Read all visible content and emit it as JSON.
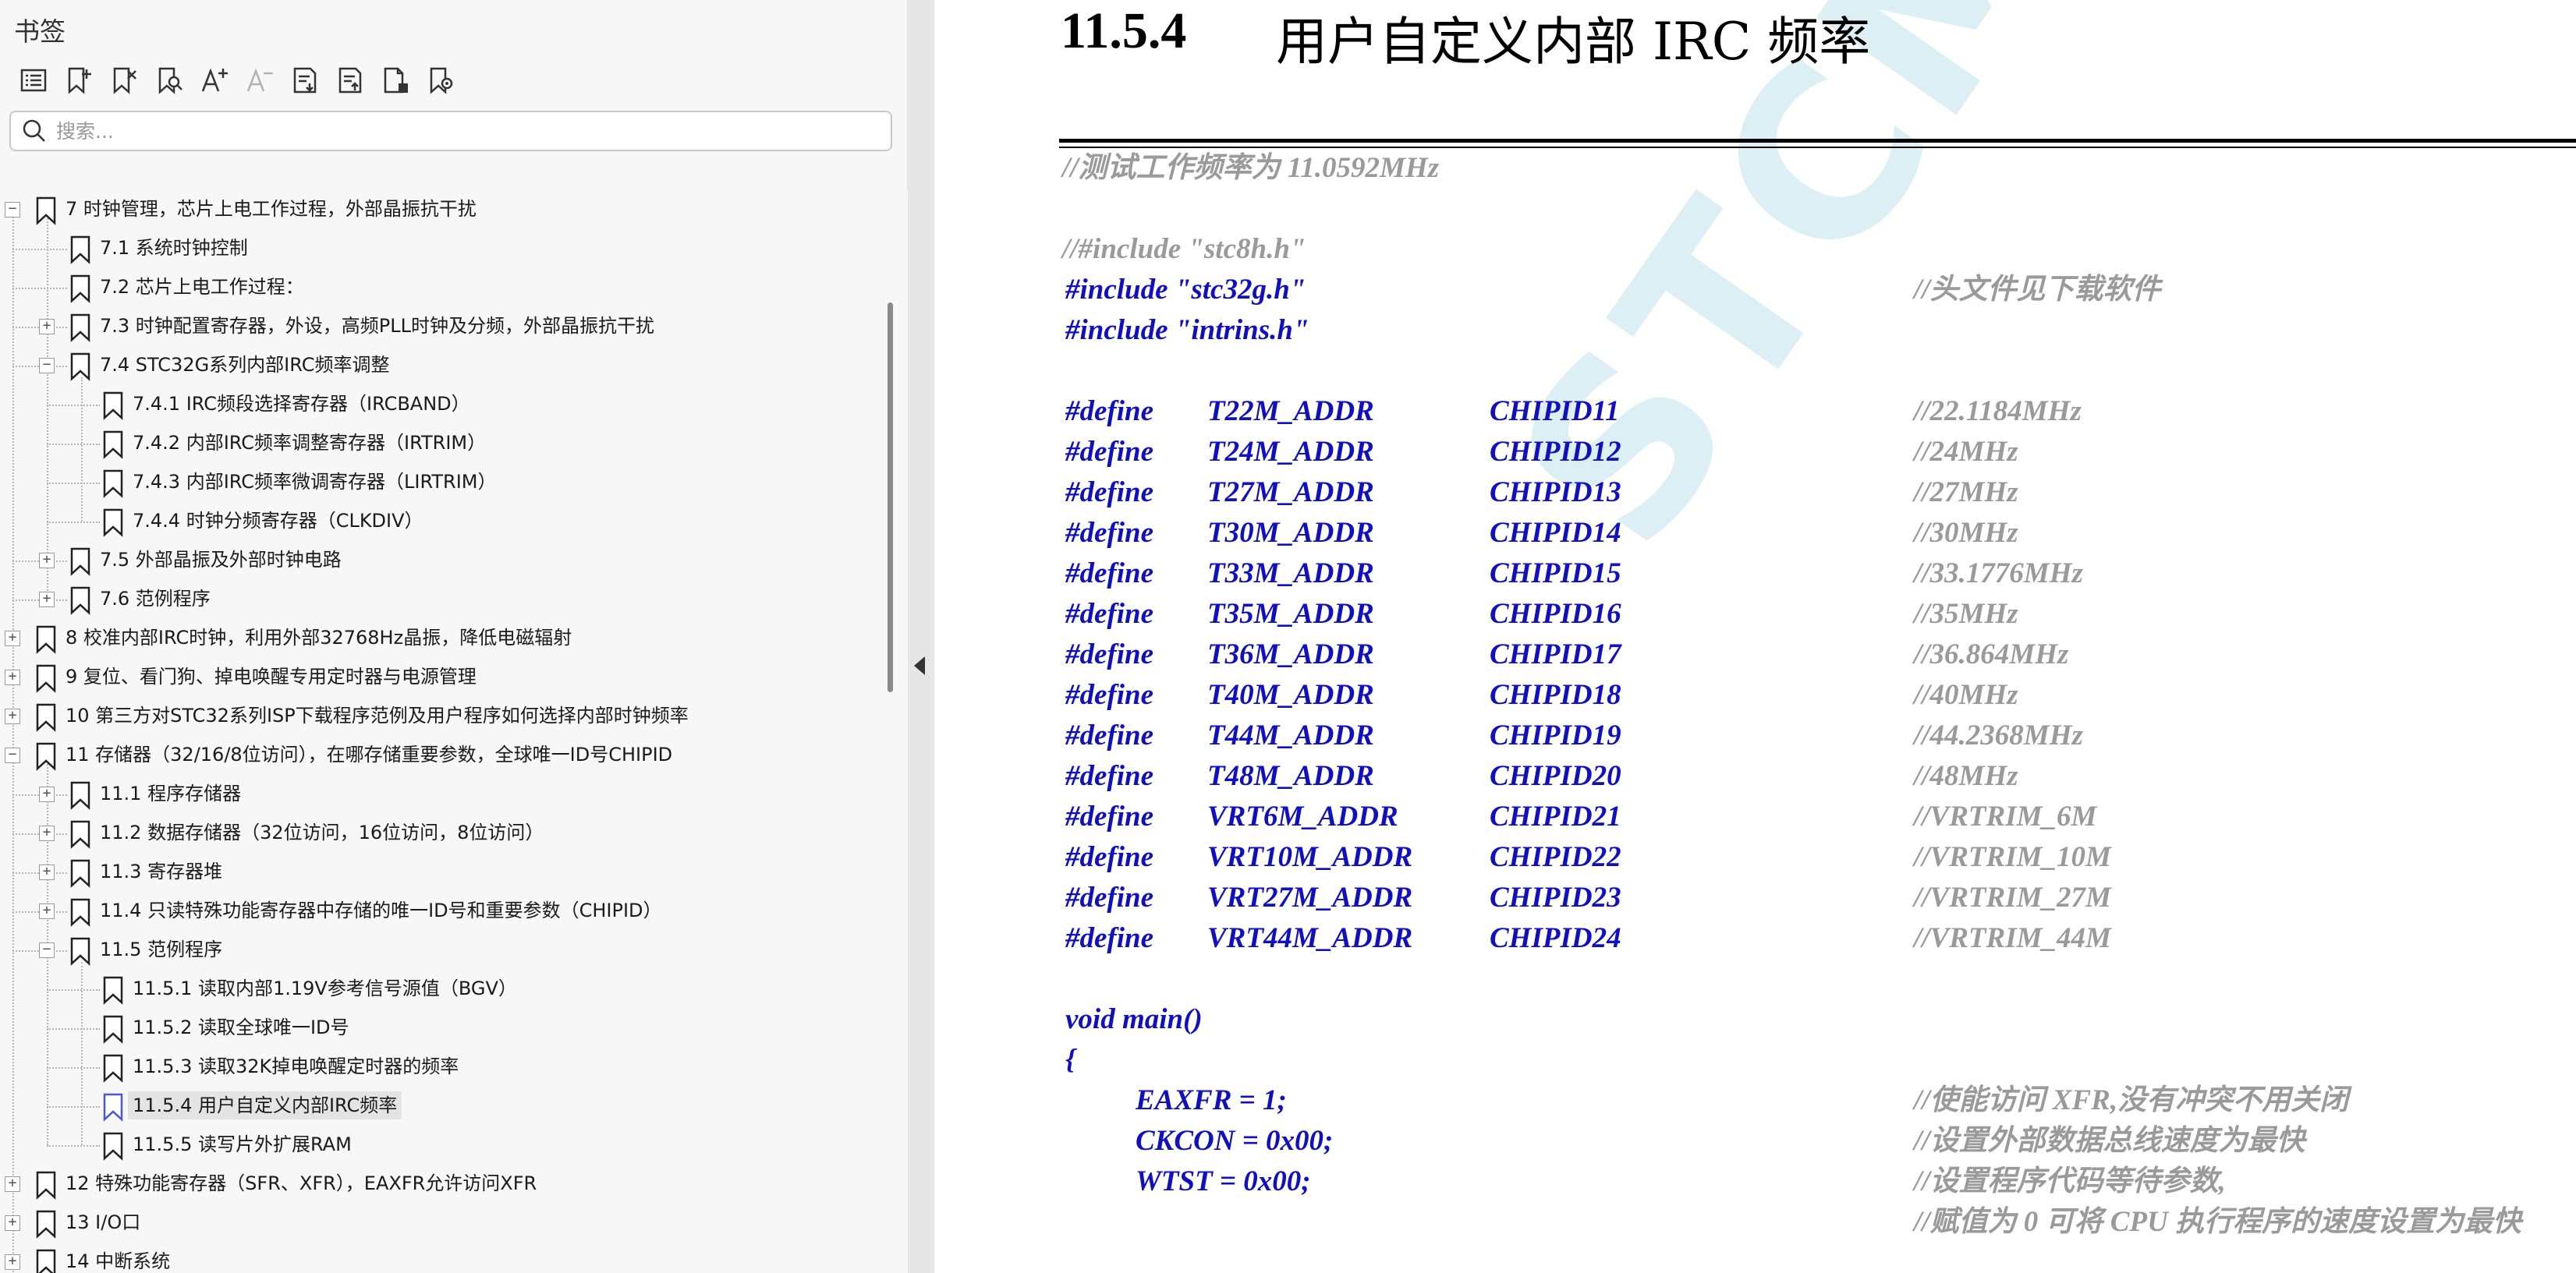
{
  "sidebar": {
    "title": "书签",
    "search_placeholder": "搜索...",
    "toolbar": [
      {
        "icon": "list-view-icon"
      },
      {
        "icon": "add-bookmark-icon"
      },
      {
        "icon": "delete-bookmark-icon"
      },
      {
        "icon": "find-bookmark-icon"
      },
      {
        "icon": "increase-font-icon"
      },
      {
        "icon": "decrease-font-icon"
      },
      {
        "icon": "expand-all-icon"
      },
      {
        "icon": "collapse-all-icon"
      },
      {
        "icon": "bookmark-properties-icon"
      },
      {
        "icon": "bookmark-settings-icon"
      }
    ],
    "tree": [
      {
        "label": "7 时钟管理，芯片上电工作过程，外部晶振抗干扰",
        "level": 0,
        "expander": "minus"
      },
      {
        "label": "7.1 系统时钟控制",
        "level": 1,
        "expander": ""
      },
      {
        "label": "7.2 芯片上电工作过程：",
        "level": 1,
        "expander": ""
      },
      {
        "label": "7.3 时钟配置寄存器，外设，高频PLL时钟及分频，外部晶振抗干扰",
        "level": 1,
        "expander": "plus"
      },
      {
        "label": "7.4 STC32G系列内部IRC频率调整",
        "level": 1,
        "expander": "minus"
      },
      {
        "label": "7.4.1 IRC频段选择寄存器（IRCBAND）",
        "level": 2,
        "expander": ""
      },
      {
        "label": "7.4.2 内部IRC频率调整寄存器（IRTRIM）",
        "level": 2,
        "expander": ""
      },
      {
        "label": "7.4.3  内部IRC频率微调寄存器（LIRTRIM）",
        "level": 2,
        "expander": ""
      },
      {
        "label": "7.4.4 时钟分频寄存器（CLKDIV）",
        "level": 2,
        "expander": ""
      },
      {
        "label": "7.5  外部晶振及外部时钟电路",
        "level": 1,
        "expander": "plus"
      },
      {
        "label": "7.6  范例程序",
        "level": 1,
        "expander": "plus"
      },
      {
        "label": "8  校准内部IRC时钟，利用外部32768Hz晶振，降低电磁辐射",
        "level": 0,
        "expander": "plus"
      },
      {
        "label": "9  复位、看门狗、掉电唤醒专用定时器与电源管理",
        "level": 0,
        "expander": "plus"
      },
      {
        "label": "10  第三方对STC32系列ISP下载程序范例及用户程序如何选择内部时钟频率",
        "level": 0,
        "expander": "plus"
      },
      {
        "label": "11  存储器（32/16/8位访问），在哪存储重要参数，全球唯一ID号CHIPID",
        "level": 0,
        "expander": "minus"
      },
      {
        "label": "11.1  程序存储器",
        "level": 1,
        "expander": "plus"
      },
      {
        "label": "11.2  数据存储器（32位访问，16位访问，8位访问）",
        "level": 1,
        "expander": "plus"
      },
      {
        "label": "11.3  寄存器堆",
        "level": 1,
        "expander": "plus"
      },
      {
        "label": "11.4  只读特殊功能寄存器中存储的唯一ID号和重要参数（CHIPID）",
        "level": 1,
        "expander": "plus"
      },
      {
        "label": "11.5  范例程序",
        "level": 1,
        "expander": "minus"
      },
      {
        "label": "11.5.1 读取内部1.19V参考信号源值（BGV）",
        "level": 2,
        "expander": ""
      },
      {
        "label": "11.5.2 读取全球唯一ID号",
        "level": 2,
        "expander": ""
      },
      {
        "label": "11.5.3 读取32K掉电唤醒定时器的频率",
        "level": 2,
        "expander": ""
      },
      {
        "label": "11.5.4 用户自定义内部IRC频率",
        "level": 2,
        "expander": "",
        "selected": true
      },
      {
        "label": "11.5.5 读写片外扩展RAM",
        "level": 2,
        "expander": ""
      },
      {
        "label": "12  特殊功能寄存器（SFR、XFR），EAXFR允许访问XFR",
        "level": 0,
        "expander": "plus"
      },
      {
        "label": "13  I/O口",
        "level": 0,
        "expander": "plus"
      },
      {
        "label": "14  中断系统",
        "level": 0,
        "expander": "plus"
      }
    ]
  },
  "document": {
    "watermark": "STCMCU",
    "heading_number": "11.5.4",
    "heading_title": "用户自定义内部 IRC 频率",
    "comment_freq": "//测试工作频率为 11.0592MHz",
    "include_stc8h": "//#include \"stc8h.h\"",
    "include_stc32g": "#include \"stc32g.h\"",
    "include_stc32g_comment": "//头文件见下载软件",
    "include_intrins": "#include \"intrins.h\"",
    "defines": [
      {
        "kw": "#define",
        "name": "T22M_ADDR",
        "value": "CHIPID11",
        "comment": "//22.1184MHz"
      },
      {
        "kw": "#define",
        "name": "T24M_ADDR",
        "value": "CHIPID12",
        "comment": "//24MHz"
      },
      {
        "kw": "#define",
        "name": "T27M_ADDR",
        "value": "CHIPID13",
        "comment": "//27MHz"
      },
      {
        "kw": "#define",
        "name": "T30M_ADDR",
        "value": "CHIPID14",
        "comment": "//30MHz"
      },
      {
        "kw": "#define",
        "name": "T33M_ADDR",
        "value": "CHIPID15",
        "comment": "//33.1776MHz"
      },
      {
        "kw": "#define",
        "name": "T35M_ADDR",
        "value": "CHIPID16",
        "comment": "//35MHz"
      },
      {
        "kw": "#define",
        "name": "T36M_ADDR",
        "value": "CHIPID17",
        "comment": "//36.864MHz"
      },
      {
        "kw": "#define",
        "name": "T40M_ADDR",
        "value": "CHIPID18",
        "comment": "//40MHz"
      },
      {
        "kw": "#define",
        "name": "T44M_ADDR",
        "value": "CHIPID19",
        "comment": "//44.2368MHz"
      },
      {
        "kw": "#define",
        "name": "T48M_ADDR",
        "value": "CHIPID20",
        "comment": "//48MHz"
      },
      {
        "kw": "#define",
        "name": "VRT6M_ADDR",
        "value": "CHIPID21",
        "comment": "//VRTRIM_6M"
      },
      {
        "kw": "#define",
        "name": "VRT10M_ADDR",
        "value": "CHIPID22",
        "comment": "//VRTRIM_10M"
      },
      {
        "kw": "#define",
        "name": "VRT27M_ADDR",
        "value": "CHIPID23",
        "comment": "//VRTRIM_27M"
      },
      {
        "kw": "#define",
        "name": "VRT44M_ADDR",
        "value": "CHIPID24",
        "comment": "//VRTRIM_44M"
      }
    ],
    "main_sig": "void main()",
    "brace_open": "{",
    "body": [
      {
        "code": "EAXFR = 1;",
        "comment": "//使能访问 XFR,没有冲突不用关闭"
      },
      {
        "code": "CKCON = 0x00;",
        "comment": "//设置外部数据总线速度为最快"
      },
      {
        "code": "WTST = 0x00;",
        "comment": "//设置程序代码等待参数,"
      }
    ],
    "trailing_comment": "//赋值为 0 可将 CPU 执行程序的速度设置为最快"
  }
}
